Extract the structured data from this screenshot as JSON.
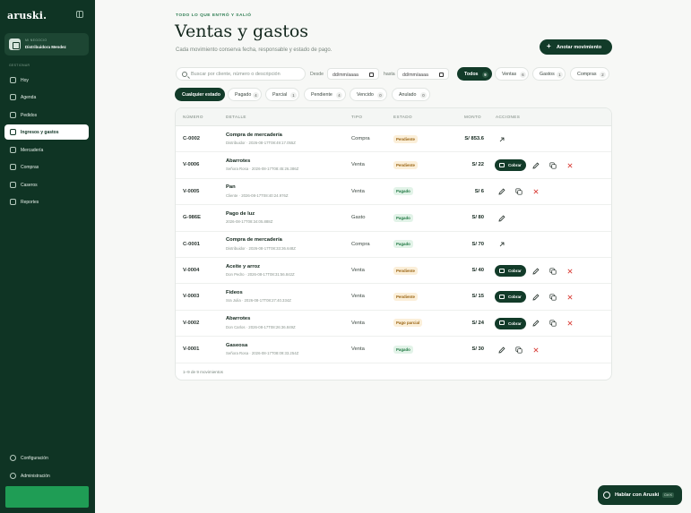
{
  "sidebar": {
    "logo": "aruski.",
    "business": {
      "label": "MI NEGOCIO",
      "name": "Distribuidora Mendez"
    },
    "section_label": "GESTIONAR",
    "items": [
      {
        "label": "Hoy",
        "icon": "home-icon"
      },
      {
        "label": "Agenda",
        "icon": "calendar-icon"
      },
      {
        "label": "Pedidos",
        "icon": "clipboard-icon"
      },
      {
        "label": "Ingresos y gastos",
        "icon": "swap-icon"
      },
      {
        "label": "Mercadería",
        "icon": "box-icon"
      },
      {
        "label": "Compras",
        "icon": "cart-icon"
      },
      {
        "label": "Caseros",
        "icon": "users-icon"
      },
      {
        "label": "Reportes",
        "icon": "chart-icon"
      }
    ],
    "bottom_items": [
      {
        "label": "Configuración",
        "icon": "gear-icon"
      },
      {
        "label": "Administración",
        "icon": "shield-icon"
      }
    ]
  },
  "header": {
    "eyebrow": "TODO LO QUE ENTRÓ Y SALIÓ",
    "title": "Ventas y gastos",
    "subtitle": "Cada movimiento conserva fecha, responsable y estado de pago.",
    "primary_button": "Anotar movimiento"
  },
  "filters": {
    "search_placeholder": "Buscar por cliente, número o descripción",
    "desde_label": "Desde",
    "hasta_label": "hasta",
    "date_placeholder": "dd/mm/aaaa",
    "type_chips": [
      {
        "label": "Todos",
        "count": "9"
      },
      {
        "label": "Ventas",
        "count": "6"
      },
      {
        "label": "Gastos",
        "count": "1"
      },
      {
        "label": "Compras",
        "count": "2"
      }
    ],
    "status_chips": [
      {
        "label": "Cualquier estado",
        "count": ""
      },
      {
        "label": "Pagado",
        "count": "4"
      },
      {
        "label": "Parcial",
        "count": "1"
      },
      {
        "label": "Pendiente",
        "count": "4"
      },
      {
        "label": "Vencido",
        "count": "0"
      },
      {
        "label": "Anulado",
        "count": "0"
      }
    ]
  },
  "table": {
    "headers": [
      "NÚMERO",
      "DETALLE",
      "TIPO",
      "ESTADO",
      "MONTO",
      "ACCIONES"
    ],
    "cobrar_label": "Cobrar",
    "rows": [
      {
        "num": "C-0002",
        "title": "Compra de mercadería",
        "sub": "Distribuidor · 2026-08-17T08:49:17.055Z",
        "type": "Compra",
        "status": "Pendiente",
        "amount": "S/ 853.6"
      },
      {
        "num": "V-0006",
        "title": "Abarrotes",
        "sub": "Señora Rosa · 2026-08-17T08:45:26.386Z",
        "type": "Venta",
        "status": "Pendiente",
        "amount": "S/ 22"
      },
      {
        "num": "V-0005",
        "title": "Pan",
        "sub": "Cliente · 2026-08-17T08:40:24.976Z",
        "type": "Venta",
        "status": "Pagado",
        "amount": "S/ 6"
      },
      {
        "num": "G-986E",
        "title": "Pago de luz",
        "sub": "2026-08-17T08:34:05.888Z",
        "type": "Gasto",
        "status": "Pagado",
        "amount": "S/ 80"
      },
      {
        "num": "C-0001",
        "title": "Compra de mercadería",
        "sub": "Distribuidor · 2026-08-17T08:33:36.648Z",
        "type": "Compra",
        "status": "Pagado",
        "amount": "S/ 70"
      },
      {
        "num": "V-0004",
        "title": "Aceite y arroz",
        "sub": "Don Pedro · 2026-08-17T08:31:56.842Z",
        "type": "Venta",
        "status": "Pendiente",
        "amount": "S/ 40"
      },
      {
        "num": "V-0003",
        "title": "Fideos",
        "sub": "Sra Julia · 2026-08-17T08:27:40.334Z",
        "type": "Venta",
        "status": "Pendiente",
        "amount": "S/ 15"
      },
      {
        "num": "V-0002",
        "title": "Abarrotes",
        "sub": "Don Carlos · 2026-08-17T08:26:36.849Z",
        "type": "Venta",
        "status": "Pago parcial",
        "amount": "S/ 24"
      },
      {
        "num": "V-0001",
        "title": "Gaseosa",
        "sub": "Señora Rosa · 2026-08-17T08:09:33.254Z",
        "type": "Venta",
        "status": "Pagado",
        "amount": "S/ 30"
      }
    ],
    "footer": "1–9 de 9 movimientos"
  },
  "chat": {
    "label": "Hablar con Aruski",
    "shortcut": "Ctrl K"
  },
  "colors": {
    "sidebar": "#0f3424",
    "accent": "#123b29",
    "pending": "#9a6412",
    "paid": "#237a45"
  }
}
